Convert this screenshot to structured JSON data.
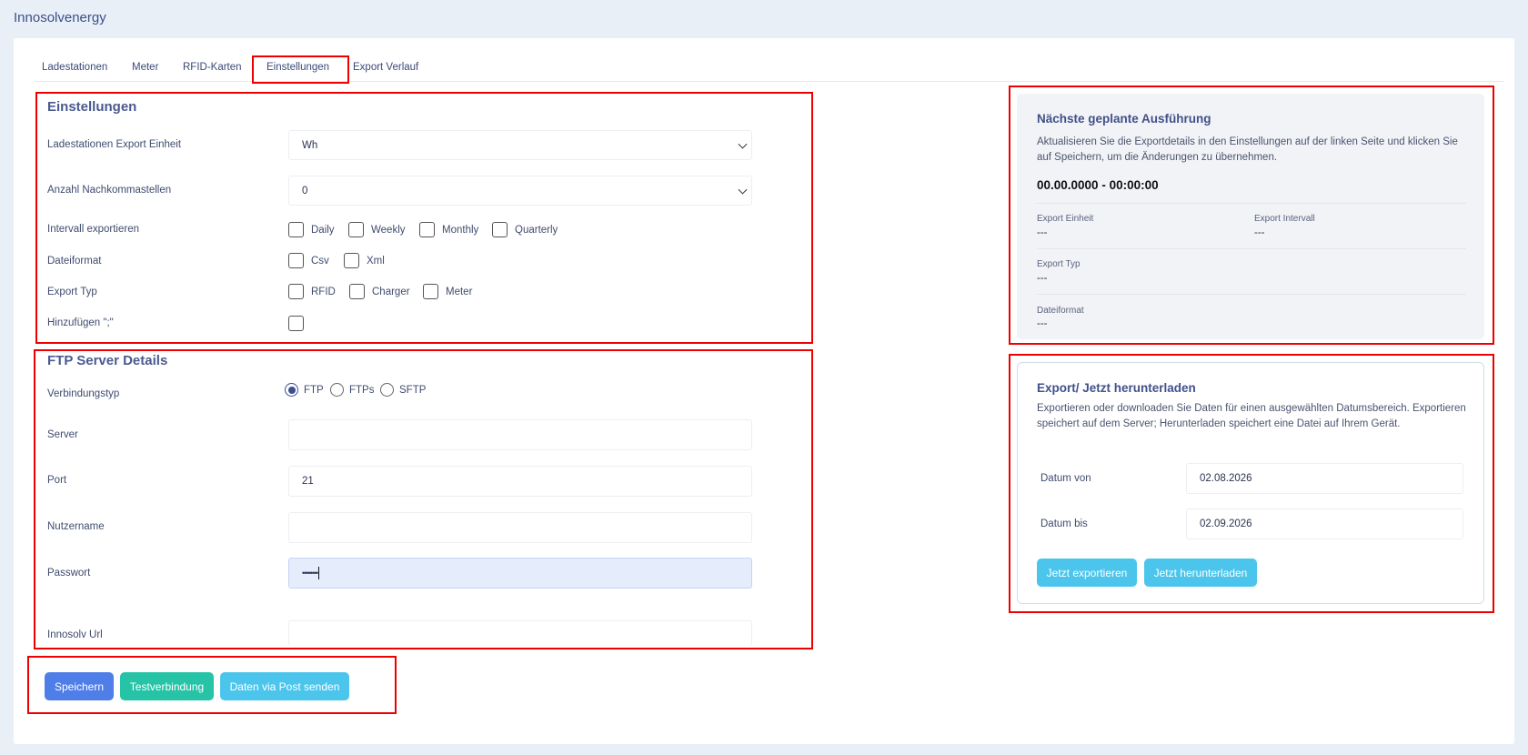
{
  "app": {
    "title": "Innosolvenergy"
  },
  "tabs": [
    {
      "label": "Ladestationen"
    },
    {
      "label": "Meter"
    },
    {
      "label": "RFID-Karten"
    },
    {
      "label": "Einstellungen"
    },
    {
      "label": "Export Verlauf"
    }
  ],
  "settings": {
    "title": "Einstellungen",
    "export_unit": {
      "label": "Ladestationen Export Einheit",
      "value": "Wh"
    },
    "decimals": {
      "label": "Anzahl Nachkommastellen",
      "value": "0"
    },
    "interval": {
      "label": "Intervall exportieren",
      "options": [
        "Daily",
        "Weekly",
        "Monthly",
        "Quarterly"
      ]
    },
    "file_format": {
      "label": "Dateiformat",
      "options": [
        "Csv",
        "Xml"
      ]
    },
    "export_type": {
      "label": "Export Typ",
      "options": [
        "RFID",
        "Charger",
        "Meter"
      ]
    },
    "semicolon": {
      "label": "Hinzufügen \";\""
    }
  },
  "ftp": {
    "title": "FTP Server Details",
    "connection_type": {
      "label": "Verbindungstyp",
      "options": [
        "FTP",
        "FTPs",
        "SFTP"
      ],
      "selected": "FTP"
    },
    "server": {
      "label": "Server",
      "value": ""
    },
    "port": {
      "label": "Port",
      "value": "21"
    },
    "username": {
      "label": "Nutzername",
      "value": ""
    },
    "password": {
      "label": "Passwort",
      "value": "••••••••"
    },
    "url": {
      "label": "Innosolv Url",
      "value": ""
    }
  },
  "buttons": {
    "save": "Speichern",
    "test": "Testverbindung",
    "post": "Daten via Post senden"
  },
  "next_run": {
    "title": "Nächste geplante Ausführung",
    "text": "Aktualisieren Sie die Exportdetails in den Einstellungen auf der linken Seite und klicken Sie auf Speichern, um die Änderungen zu übernehmen.",
    "datetime": "00.00.0000 - 00:00:00",
    "export_unit": {
      "label": "Export Einheit",
      "value": "---"
    },
    "export_interval": {
      "label": "Export Intervall",
      "value": "---"
    },
    "export_type": {
      "label": "Export Typ",
      "value": "---"
    },
    "file_format": {
      "label": "Dateiformat",
      "value": "---"
    }
  },
  "export_now": {
    "title": "Export/ Jetzt herunterladen",
    "text": "Exportieren oder downloaden Sie Daten für einen ausgewählten Datumsbereich. Exportieren speichert auf dem Server; Herunterladen speichert eine Datei auf Ihrem Gerät.",
    "date_from": {
      "label": "Datum von",
      "value": "02.08.2026"
    },
    "date_to": {
      "label": "Datum bis",
      "value": "02.09.2026"
    },
    "export_button": "Jetzt exportieren",
    "download_button": "Jetzt herunterladen"
  }
}
